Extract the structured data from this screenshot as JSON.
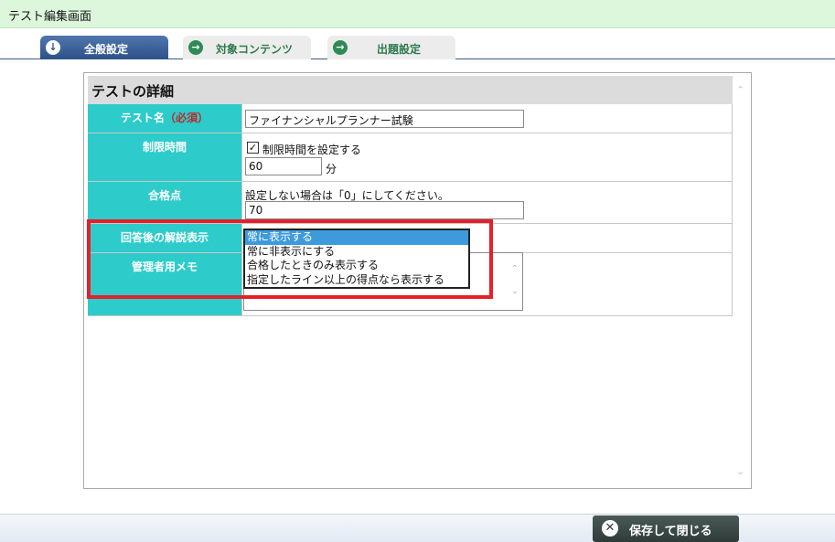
{
  "window": {
    "title": "テスト編集画面"
  },
  "tabs": [
    {
      "label": "全般設定",
      "active": true,
      "icon": "arrow-down-icon"
    },
    {
      "label": "対象コンテンツ",
      "active": false,
      "icon": "arrow-right-icon"
    },
    {
      "label": "出題設定",
      "active": false,
      "icon": "arrow-right-icon"
    }
  ],
  "section": {
    "title": "テストの詳細"
  },
  "fields": {
    "test_name": {
      "label": "テスト名",
      "required": "（必須）",
      "value": "ファイナンシャルプランナー試験"
    },
    "time_limit": {
      "label": "制限時間",
      "checkbox_label": "制限時間を設定する",
      "checked": true,
      "value": "60",
      "unit": "分"
    },
    "pass_score": {
      "label": "合格点",
      "hint": "設定しない場合は「0」にしてください。",
      "value": "70"
    },
    "explanation": {
      "label": "回答後の解説表示",
      "options": [
        "常に表示する",
        "常に非表示にする",
        "合格したときのみ表示する",
        "指定したライン以上の得点なら表示する"
      ],
      "selected": "常に表示する"
    },
    "memo": {
      "label": "管理者用メモ",
      "value": ""
    }
  },
  "footer": {
    "save_label": "保存して閉じる"
  },
  "colors": {
    "label_bg": "#2ecbcb",
    "highlight": "#e5202a",
    "tab_active": "#2c5288",
    "required": "#c0282a"
  }
}
